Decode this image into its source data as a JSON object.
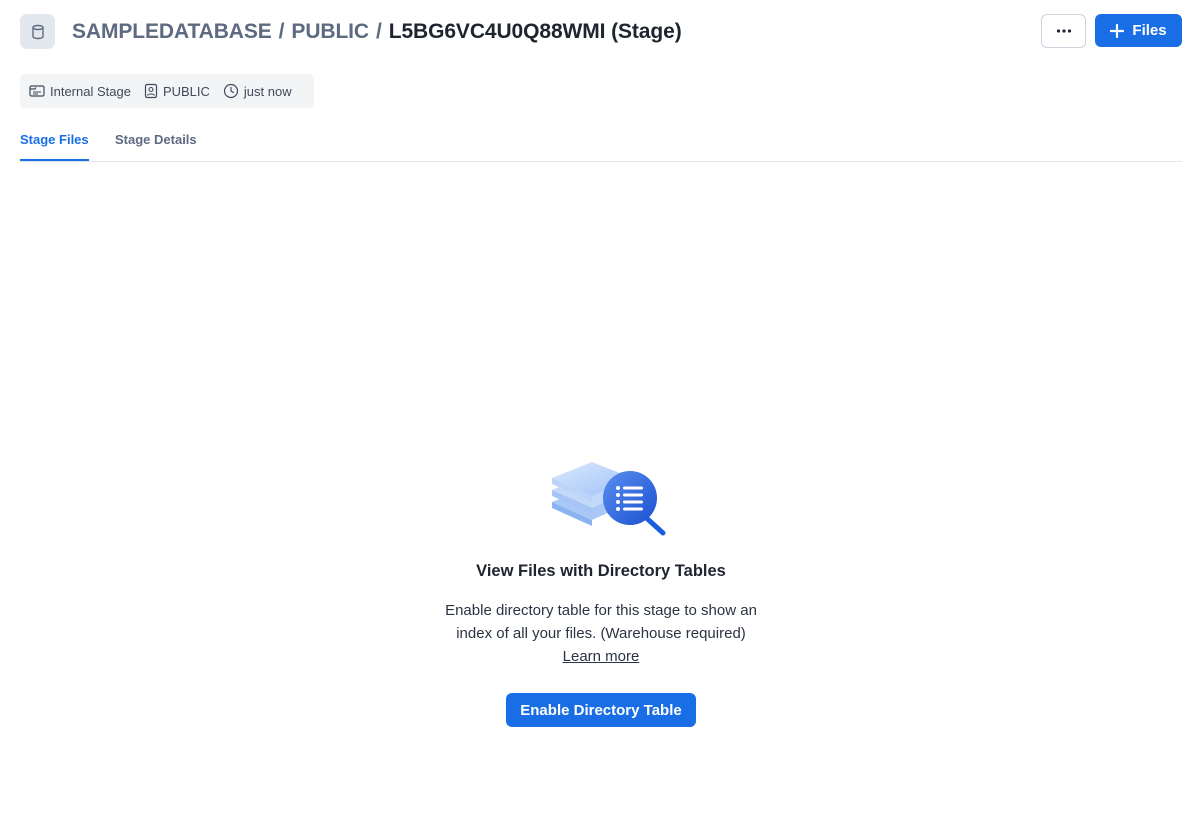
{
  "header": {
    "breadcrumb": [
      "SAMPLEDATABASE",
      "PUBLIC"
    ],
    "separator": "/",
    "current": "L5BG6VC4U0Q88WMI (Stage)",
    "more_icon": "ellipsis-icon",
    "files_button_label": "Files",
    "files_button_icon": "plus-icon",
    "db_icon": "database-icon"
  },
  "meta": {
    "stage_type": "Internal Stage",
    "owner": "PUBLIC",
    "updated": "just now"
  },
  "tabs": [
    {
      "label": "Stage Files",
      "active": true
    },
    {
      "label": "Stage Details",
      "active": false
    }
  ],
  "empty_state": {
    "title": "View Files with Directory Tables",
    "description_line1": "Enable directory table for this stage to show an",
    "description_line2": "index of all your files. (Warehouse required)",
    "learn_more": "Learn more",
    "button_label": "Enable Directory Table",
    "illustration_icon": "directory-search-illustration"
  },
  "colors": {
    "accent": "#1a6ee5",
    "muted_text": "#5d6a80",
    "text": "#1e252f"
  }
}
